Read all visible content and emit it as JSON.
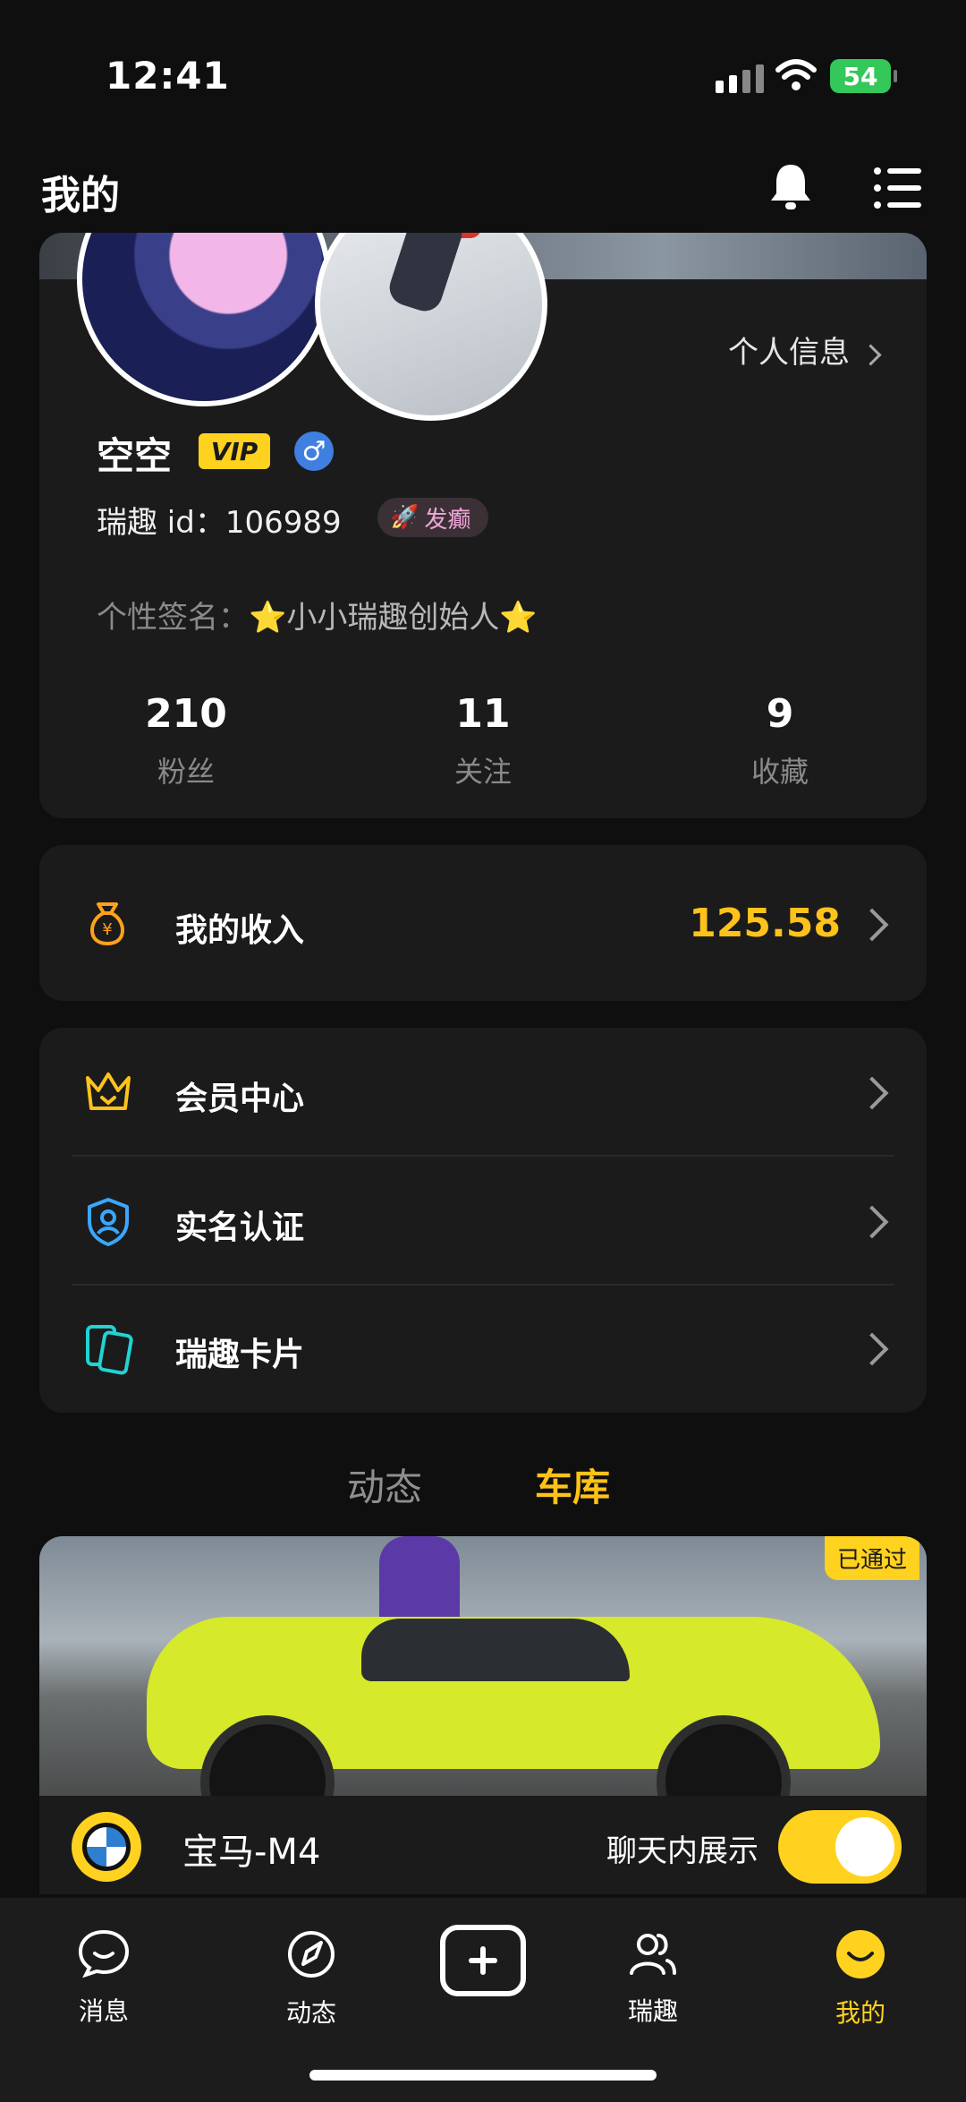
{
  "status_bar": {
    "time": "12:41",
    "battery": "54"
  },
  "header": {
    "title": "我的"
  },
  "profile": {
    "info_link": "个人信息",
    "name": "空空",
    "vip": "VIP",
    "gender_symbol": "♂",
    "id_label": "瑞趣 id：",
    "id_value": "106989",
    "tag": "发癫",
    "signature_label": "个性签名：",
    "signature_value": "⭐小小瑞趣创始人⭐",
    "stats": [
      {
        "value": "210",
        "label": "粉丝"
      },
      {
        "value": "11",
        "label": "关注"
      },
      {
        "value": "9",
        "label": "收藏"
      }
    ]
  },
  "income": {
    "label": "我的收入",
    "value": "125.58"
  },
  "menu": [
    {
      "label": "会员中心",
      "icon": "crown-icon"
    },
    {
      "label": "实名认证",
      "icon": "shield-user-icon"
    },
    {
      "label": "瑞趣卡片",
      "icon": "cards-icon"
    }
  ],
  "content_tabs": {
    "inactive": "动态",
    "active": "车库"
  },
  "car": {
    "status_badge": "已通过",
    "name": "宝马-M4",
    "chat_display_label": "聊天内展示",
    "chat_display_on": true
  },
  "tabbar": [
    {
      "label": "消息",
      "icon": "message-icon"
    },
    {
      "label": "动态",
      "icon": "compass-icon"
    },
    {
      "label": "",
      "icon": "add-icon"
    },
    {
      "label": "瑞趣",
      "icon": "group-icon"
    },
    {
      "label": "我的",
      "icon": "smile-icon",
      "active": true
    }
  ],
  "colors": {
    "accent": "#ffc21a",
    "vip": "#ffd21f",
    "background": "#0f0f0f",
    "card": "#1b1b1b"
  }
}
